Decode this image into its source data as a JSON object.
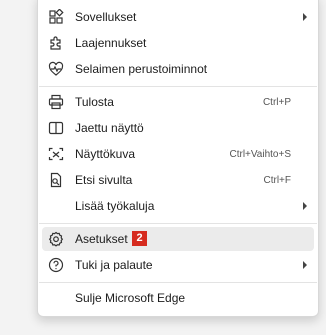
{
  "menu": {
    "items": [
      {
        "label": "Sovellukset",
        "icon": "apps-icon"
      },
      {
        "label": "Laajennukset",
        "icon": "extensions-icon"
      },
      {
        "label": "Selaimen perustoiminnot",
        "icon": "browser-essentials-icon"
      },
      {
        "label": "Tulosta",
        "shortcut": "Ctrl+P",
        "icon": "print-icon"
      },
      {
        "label": "Jaettu näyttö",
        "icon": "split-screen-icon"
      },
      {
        "label": "Näyttökuva",
        "shortcut": "Ctrl+Vaihto+S",
        "icon": "screenshot-icon"
      },
      {
        "label": "Etsi sivulta",
        "shortcut": "Ctrl+F",
        "icon": "find-on-page-icon"
      },
      {
        "label": "Lisää työkaluja"
      },
      {
        "label": "Asetukset",
        "badge": "2",
        "icon": "settings-icon"
      },
      {
        "label": "Tuki ja palaute",
        "icon": "help-icon"
      },
      {
        "label": "Sulje Microsoft Edge"
      }
    ]
  },
  "colors": {
    "badge": "#d62b1f",
    "highlight": "#ebebeb"
  }
}
